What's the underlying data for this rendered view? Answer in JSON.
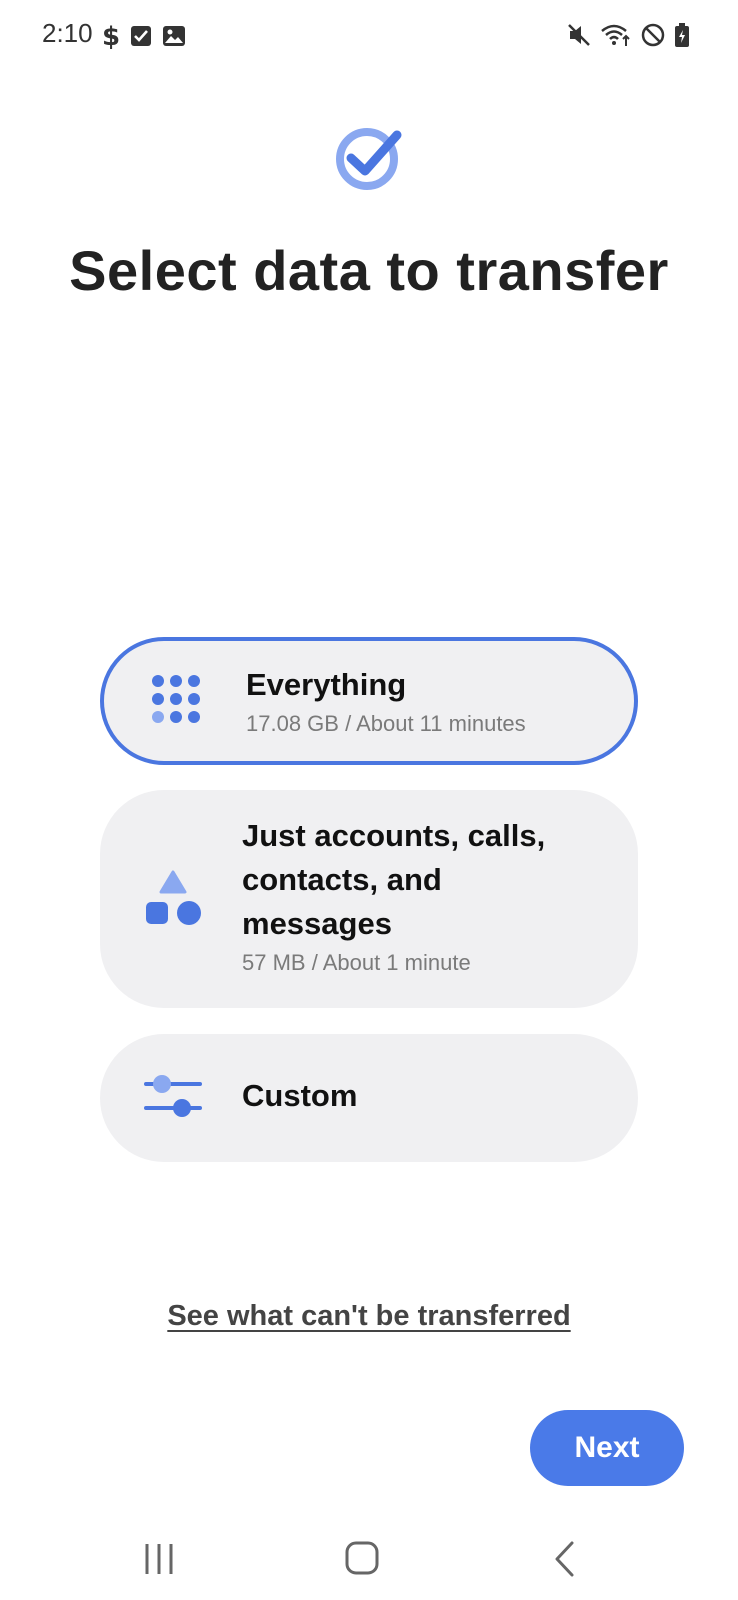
{
  "status_bar": {
    "time": "2:10",
    "left_icons": [
      "dollar-icon",
      "checkbox-icon",
      "image-icon"
    ],
    "right_icons": [
      "mute-icon",
      "wifi-icon",
      "do-not-disturb-icon",
      "battery-icon"
    ]
  },
  "title": "Select data to transfer",
  "options": [
    {
      "icon": "grid-dots-icon",
      "title": "Everything",
      "subtitle": "17.08 GB / About 11 minutes",
      "selected": true
    },
    {
      "icon": "shapes-icon",
      "title": "Just accounts, calls, contacts, and messages",
      "subtitle": "57 MB / About 1 minute",
      "selected": false
    },
    {
      "icon": "sliders-icon",
      "title": "Custom",
      "subtitle": "",
      "selected": false
    }
  ],
  "info_link": "See what can't be transferred",
  "next_label": "Next",
  "nav": [
    "recents-icon",
    "home-icon",
    "back-icon"
  ],
  "colors": {
    "accent": "#4a7ae8",
    "card_bg": "#f0f0f2",
    "selected_border": "#4a76e0"
  }
}
